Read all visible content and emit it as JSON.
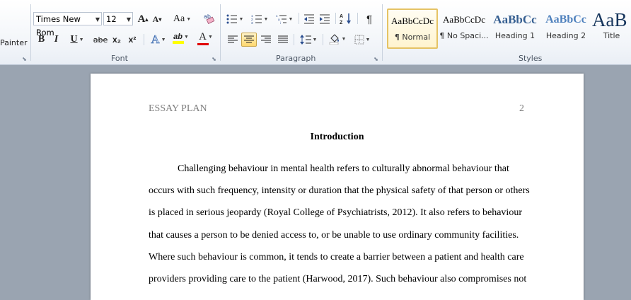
{
  "clipboard": {
    "painter_label": "Painter"
  },
  "font": {
    "group_label": "Font",
    "name_value": "Times New Rom",
    "size_value": "12",
    "grow_label": "A",
    "shrink_label": "A",
    "case_label": "Aa",
    "bold_label": "B",
    "italic_label": "I",
    "underline_label": "U",
    "strike_label": "abe",
    "subscript_label": "x₂",
    "superscript_label": "x²",
    "effects_label": "A",
    "highlight_label": "ab",
    "color_label": "A",
    "highlight_color": "#ffff00",
    "font_color": "#e00000"
  },
  "paragraph": {
    "group_label": "Paragraph",
    "pilcrow_label": "¶"
  },
  "styles": {
    "group_label": "Styles",
    "items": [
      {
        "sample": "AaBbCcDc",
        "name": "¶ Normal"
      },
      {
        "sample": "AaBbCcDc",
        "name": "¶ No Spaci..."
      },
      {
        "sample": "AaBbCc",
        "name": "Heading 1"
      },
      {
        "sample": "AaBbCc",
        "name": "Heading 2"
      },
      {
        "sample": "AaB",
        "name": "Title"
      }
    ]
  },
  "document": {
    "header_left": "ESSAY PLAN",
    "header_right": "2",
    "heading": "Introduction",
    "lines": [
      "Challenging behaviour in mental health refers to culturally abnormal behaviour that",
      "occurs with such frequency, intensity or duration that the physical safety of that person or others",
      "is placed in serious jeopardy (Royal College of Psychiatrists, 2012). It also refers to behaviour",
      "that causes a person to be denied access to, or be unable to use ordinary community facilities.",
      "Where such behaviour is common, it tends to create a barrier between a patient and health care",
      "providers providing care to the patient (Harwood, 2017). Such behaviour also compromises not"
    ]
  }
}
